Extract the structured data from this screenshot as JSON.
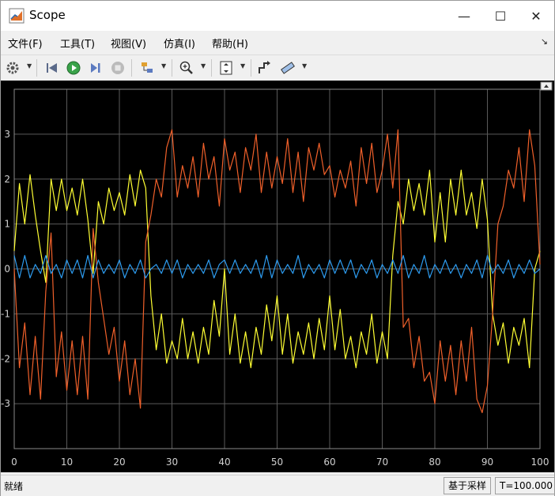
{
  "window": {
    "title": "Scope",
    "minimize_glyph": "—",
    "maximize_glyph": "☐",
    "close_glyph": "✕",
    "undock_glyph": "↘"
  },
  "menu": [
    "文件(F)",
    "工具(T)",
    "视图(V)",
    "仿真(I)",
    "帮助(H)"
  ],
  "toolbar_icons": [
    "gear-icon",
    "rewind-icon",
    "run-icon",
    "step-forward-icon",
    "stop-icon",
    "highlight-icon",
    "zoom-in-icon",
    "autoscale-icon",
    "signal-select-icon",
    "measurements-icon"
  ],
  "status": {
    "left": "就绪",
    "sample": "基于采样",
    "time": "T=100.000"
  },
  "colors": {
    "plot_bg": "#000000",
    "grid": "#5a5a5a",
    "tick_text": "#d0d0d0",
    "yellow": "#ffff33",
    "orange": "#f0602a",
    "blue": "#2d9cf0"
  },
  "chart_data": {
    "type": "line",
    "title": "",
    "xlabel": "",
    "ylabel": "",
    "xlim": [
      0,
      100
    ],
    "ylim": [
      -4,
      4
    ],
    "xticks": [
      0,
      10,
      20,
      30,
      40,
      50,
      60,
      70,
      80,
      90,
      100
    ],
    "yticks": [
      -3,
      -2,
      -1,
      0,
      1,
      2,
      3
    ],
    "grid": true,
    "series": [
      {
        "color": "yellow",
        "x": [
          0,
          1,
          2,
          3,
          4,
          5,
          6,
          7,
          8,
          9,
          10,
          11,
          12,
          13,
          14,
          15,
          16,
          17,
          18,
          19,
          20,
          21,
          22,
          23,
          24,
          25,
          26,
          27,
          28,
          29,
          30,
          31,
          32,
          33,
          34,
          35,
          36,
          37,
          38,
          39,
          40,
          41,
          42,
          43,
          44,
          45,
          46,
          47,
          48,
          49,
          50,
          51,
          52,
          53,
          54,
          55,
          56,
          57,
          58,
          59,
          60,
          61,
          62,
          63,
          64,
          65,
          66,
          67,
          68,
          69,
          70,
          71,
          72,
          73,
          74,
          75,
          76,
          77,
          78,
          79,
          80,
          81,
          82,
          83,
          84,
          85,
          86,
          87,
          88,
          89,
          90,
          91,
          92,
          93,
          94,
          95,
          96,
          97,
          98,
          99,
          100
        ],
        "y": [
          0.4,
          1.9,
          1.0,
          2.1,
          1.2,
          0.4,
          -0.3,
          2.0,
          1.3,
          2.0,
          1.3,
          1.8,
          1.2,
          2.0,
          1.1,
          -0.1,
          1.5,
          1.0,
          1.8,
          1.3,
          1.7,
          1.2,
          2.1,
          1.4,
          2.2,
          1.8,
          -0.6,
          -1.8,
          -1.0,
          -2.1,
          -1.6,
          -2.0,
          -1.1,
          -2.0,
          -1.4,
          -2.1,
          -1.3,
          -1.9,
          -0.7,
          -1.5,
          0.0,
          -1.9,
          -1.0,
          -2.1,
          -1.4,
          -2.2,
          -1.3,
          -1.9,
          -0.8,
          -1.6,
          -0.6,
          -1.9,
          -1.0,
          -2.1,
          -1.4,
          -1.9,
          -1.2,
          -2.0,
          -1.1,
          -1.8,
          -0.6,
          -1.8,
          -0.9,
          -2.0,
          -1.5,
          -2.2,
          -1.4,
          -1.9,
          -1.0,
          -2.1,
          -1.4,
          -2.0,
          0.3,
          1.5,
          1.0,
          2.0,
          1.3,
          1.9,
          1.2,
          2.2,
          0.6,
          1.7,
          0.6,
          2.0,
          1.2,
          2.2,
          1.2,
          1.7,
          0.9,
          2.0,
          1.1,
          -1.0,
          -1.7,
          -1.2,
          -2.1,
          -1.3,
          -1.7,
          -1.1,
          -2.2,
          0.0,
          0.4
        ]
      },
      {
        "color": "orange",
        "x": [
          0,
          1,
          2,
          3,
          4,
          5,
          6,
          7,
          8,
          9,
          10,
          11,
          12,
          13,
          14,
          15,
          16,
          17,
          18,
          19,
          20,
          21,
          22,
          23,
          24,
          25,
          26,
          27,
          28,
          29,
          30,
          31,
          32,
          33,
          34,
          35,
          36,
          37,
          38,
          39,
          40,
          41,
          42,
          43,
          44,
          45,
          46,
          47,
          48,
          49,
          50,
          51,
          52,
          53,
          54,
          55,
          56,
          57,
          58,
          59,
          60,
          61,
          62,
          63,
          64,
          65,
          66,
          67,
          68,
          69,
          70,
          71,
          72,
          73,
          74,
          75,
          76,
          77,
          78,
          79,
          80,
          81,
          82,
          83,
          84,
          85,
          86,
          87,
          88,
          89,
          90,
          91,
          92,
          93,
          94,
          95,
          96,
          97,
          98,
          99,
          100
        ],
        "y": [
          0.0,
          -2.2,
          -1.2,
          -2.8,
          -1.5,
          -2.9,
          -0.5,
          0.8,
          -2.4,
          -1.4,
          -2.7,
          -1.6,
          -2.8,
          -1.5,
          -2.9,
          0.9,
          -0.3,
          -1.1,
          -1.9,
          -1.3,
          -2.5,
          -1.6,
          -2.8,
          -2.0,
          -3.1,
          0.6,
          1.2,
          2.0,
          1.6,
          2.7,
          3.1,
          1.6,
          2.3,
          1.8,
          2.5,
          1.6,
          2.8,
          2.0,
          2.5,
          1.4,
          2.9,
          2.2,
          2.6,
          1.7,
          2.7,
          2.2,
          3.0,
          1.7,
          2.6,
          1.8,
          2.5,
          1.9,
          2.9,
          1.7,
          2.6,
          1.5,
          2.7,
          2.2,
          2.8,
          2.1,
          2.3,
          1.6,
          2.2,
          1.8,
          2.4,
          1.4,
          2.7,
          1.9,
          2.8,
          1.7,
          2.2,
          3.0,
          1.8,
          3.1,
          -1.3,
          -1.1,
          -2.2,
          -1.5,
          -2.5,
          -2.3,
          -3.0,
          -1.6,
          -2.5,
          -1.7,
          -2.8,
          -1.6,
          -2.5,
          -1.3,
          -2.9,
          -3.2,
          -2.6,
          -1.0,
          1.0,
          1.4,
          2.2,
          1.8,
          2.7,
          1.5,
          3.1,
          2.3,
          0.1
        ]
      },
      {
        "color": "blue",
        "x": [
          0,
          1,
          2,
          3,
          4,
          5,
          6,
          7,
          8,
          9,
          10,
          11,
          12,
          13,
          14,
          15,
          16,
          17,
          18,
          19,
          20,
          21,
          22,
          23,
          24,
          25,
          26,
          27,
          28,
          29,
          30,
          31,
          32,
          33,
          34,
          35,
          36,
          37,
          38,
          39,
          40,
          41,
          42,
          43,
          44,
          45,
          46,
          47,
          48,
          49,
          50,
          51,
          52,
          53,
          54,
          55,
          56,
          57,
          58,
          59,
          60,
          61,
          62,
          63,
          64,
          65,
          66,
          67,
          68,
          69,
          70,
          71,
          72,
          73,
          74,
          75,
          76,
          77,
          78,
          79,
          80,
          81,
          82,
          83,
          84,
          85,
          86,
          87,
          88,
          89,
          90,
          91,
          92,
          93,
          94,
          95,
          96,
          97,
          98,
          99,
          100
        ],
        "y": [
          0.3,
          -0.2,
          0.3,
          -0.2,
          0.1,
          -0.1,
          0.3,
          -0.1,
          0.1,
          -0.2,
          0.2,
          -0.1,
          0.2,
          -0.2,
          0.3,
          -0.2,
          0.2,
          -0.1,
          0.1,
          -0.1,
          0.2,
          -0.2,
          0.1,
          -0.1,
          0.2,
          -0.2,
          0.0,
          0.1,
          -0.1,
          0.2,
          -0.1,
          0.2,
          -0.2,
          0.1,
          -0.1,
          0.1,
          -0.1,
          0.2,
          -0.2,
          0.1,
          0.2,
          -0.1,
          0.2,
          -0.1,
          0.1,
          -0.1,
          0.2,
          -0.2,
          0.3,
          -0.2,
          0.2,
          -0.1,
          0.1,
          -0.1,
          0.3,
          -0.2,
          0.1,
          -0.1,
          0.1,
          -0.2,
          0.2,
          -0.1,
          0.2,
          -0.1,
          0.2,
          -0.2,
          0.1,
          -0.1,
          0.2,
          -0.2,
          0.1,
          -0.1,
          0.2,
          -0.1,
          0.3,
          -0.2,
          0.1,
          -0.1,
          0.3,
          -0.2,
          0.1,
          -0.1,
          0.2,
          -0.1,
          0.1,
          -0.2,
          0.1,
          -0.1,
          0.2,
          -0.2,
          0.3,
          -0.1,
          0.1,
          -0.1,
          0.2,
          -0.2,
          0.1,
          -0.1,
          0.2,
          -0.1,
          0.0
        ]
      }
    ]
  }
}
